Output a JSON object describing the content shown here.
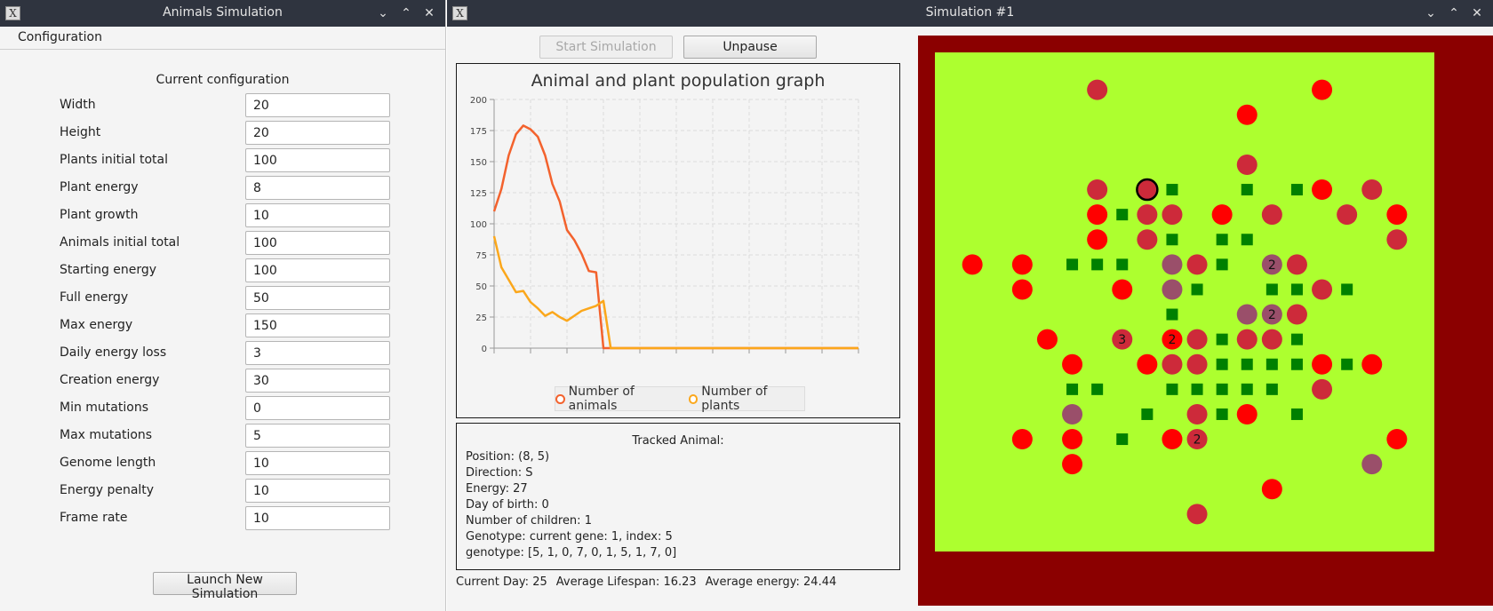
{
  "left_window": {
    "title": "Animals Simulation",
    "menu": [
      "Configuration"
    ],
    "config_title": "Current configuration",
    "fields": [
      {
        "label": "Width",
        "value": "20"
      },
      {
        "label": "Height",
        "value": "20"
      },
      {
        "label": "Plants initial total",
        "value": "100"
      },
      {
        "label": "Plant energy",
        "value": "8"
      },
      {
        "label": "Plant growth",
        "value": "10"
      },
      {
        "label": "Animals initial total",
        "value": "100"
      },
      {
        "label": "Starting energy",
        "value": "100"
      },
      {
        "label": "Full energy",
        "value": "50"
      },
      {
        "label": "Max energy",
        "value": "150"
      },
      {
        "label": "Daily energy loss",
        "value": "3"
      },
      {
        "label": "Creation energy",
        "value": "30"
      },
      {
        "label": "Min mutations",
        "value": "0"
      },
      {
        "label": "Max mutations",
        "value": "5"
      },
      {
        "label": "Genome length",
        "value": "10"
      },
      {
        "label": "Energy penalty",
        "value": "10"
      },
      {
        "label": "Frame rate",
        "value": "10"
      }
    ],
    "launch_label": "Launch New Simulation"
  },
  "right_window": {
    "title": "Simulation #1",
    "start_label": "Start Simulation",
    "unpause_label": "Unpause",
    "tracked": {
      "title": "Tracked Animal:",
      "lines": [
        "Position: (8, 5)",
        "Direction: S",
        "Energy: 27",
        "Day of birth: 0",
        "Number of children: 1",
        "Genotype: current gene: 1, index: 5",
        "genotype: [5, 1, 0, 7, 0, 1, 5, 1, 7, 0]"
      ]
    },
    "status": {
      "day": "Current Day: 25",
      "lifespan": "Average Lifespan: 16.23",
      "energy": "Average energy: 24.44"
    }
  },
  "chart_data": {
    "type": "line",
    "title": "Animal and plant population graph",
    "ylim": [
      0,
      200
    ],
    "y_ticks": [
      "0",
      "25",
      "50",
      "75",
      "100",
      "125",
      "150",
      "175",
      "200"
    ],
    "xlim": [
      0,
      25
    ],
    "series": [
      {
        "name": "Number of animals",
        "color": "#f3622d",
        "x": [
          0,
          0.5,
          1,
          1.5,
          2,
          2.5,
          3,
          3.5,
          4,
          4.5,
          5,
          5.5,
          6,
          6.5,
          7,
          7.5,
          8,
          8.5,
          9,
          9.5,
          10,
          25
        ],
        "y": [
          110,
          128,
          155,
          172,
          179,
          176,
          170,
          155,
          132,
          118,
          95,
          87,
          76,
          62,
          61,
          0,
          0,
          0,
          0,
          0,
          0,
          0
        ]
      },
      {
        "name": "Number of plants",
        "color": "#fba71b",
        "x": [
          0,
          0.5,
          1,
          1.5,
          2,
          2.5,
          3,
          3.5,
          4,
          4.5,
          5,
          5.5,
          6,
          6.5,
          7,
          7.5,
          8,
          25
        ],
        "y": [
          90,
          65,
          55,
          45,
          46,
          37,
          32,
          26,
          29,
          25,
          22,
          26,
          30,
          32,
          34,
          38,
          0,
          0
        ]
      }
    ]
  },
  "map": {
    "grid_width": 20,
    "grid_height": 20,
    "colors": {
      "border": "#8b0000",
      "steppe": "#adff2f",
      "plant": "#008000",
      "animal_full": "#ff0000",
      "animal_mid": "#cd2a3a",
      "animal_low": "#9a4f6a",
      "tracked_outline": "#000000"
    },
    "plants": [
      [
        9,
        5
      ],
      [
        12,
        5
      ],
      [
        14,
        5
      ],
      [
        7,
        6
      ],
      [
        9,
        7
      ],
      [
        11,
        7
      ],
      [
        12,
        7
      ],
      [
        5,
        8
      ],
      [
        6,
        8
      ],
      [
        7,
        8
      ],
      [
        11,
        8
      ],
      [
        10,
        9
      ],
      [
        13,
        9
      ],
      [
        14,
        9
      ],
      [
        16,
        9
      ],
      [
        9,
        10
      ],
      [
        11,
        11
      ],
      [
        14,
        11
      ],
      [
        11,
        12
      ],
      [
        12,
        12
      ],
      [
        13,
        12
      ],
      [
        14,
        12
      ],
      [
        15,
        12
      ],
      [
        16,
        12
      ],
      [
        5,
        13
      ],
      [
        6,
        13
      ],
      [
        9,
        13
      ],
      [
        10,
        13
      ],
      [
        11,
        13
      ],
      [
        12,
        13
      ],
      [
        13,
        13
      ],
      [
        8,
        14
      ],
      [
        11,
        14
      ],
      [
        14,
        14
      ],
      [
        7,
        15
      ]
    ],
    "animals": [
      {
        "x": 6,
        "y": 1,
        "level": "mid"
      },
      {
        "x": 15,
        "y": 1,
        "level": "full"
      },
      {
        "x": 12,
        "y": 2,
        "level": "full"
      },
      {
        "x": 12,
        "y": 4,
        "level": "mid"
      },
      {
        "x": 6,
        "y": 5,
        "level": "mid"
      },
      {
        "x": 8,
        "y": 5,
        "level": "mid",
        "tracked": true
      },
      {
        "x": 15,
        "y": 5,
        "level": "full"
      },
      {
        "x": 17,
        "y": 5,
        "level": "mid"
      },
      {
        "x": 6,
        "y": 6,
        "level": "full"
      },
      {
        "x": 8,
        "y": 6,
        "level": "mid"
      },
      {
        "x": 9,
        "y": 6,
        "level": "mid"
      },
      {
        "x": 11,
        "y": 6,
        "level": "full"
      },
      {
        "x": 13,
        "y": 6,
        "level": "mid"
      },
      {
        "x": 16,
        "y": 6,
        "level": "mid"
      },
      {
        "x": 18,
        "y": 6,
        "level": "full"
      },
      {
        "x": 6,
        "y": 7,
        "level": "full"
      },
      {
        "x": 8,
        "y": 7,
        "level": "mid"
      },
      {
        "x": 18,
        "y": 7,
        "level": "mid"
      },
      {
        "x": 1,
        "y": 8,
        "level": "full"
      },
      {
        "x": 3,
        "y": 8,
        "level": "full"
      },
      {
        "x": 9,
        "y": 8,
        "level": "low"
      },
      {
        "x": 10,
        "y": 8,
        "level": "mid"
      },
      {
        "x": 13,
        "y": 8,
        "level": "low",
        "count": "2"
      },
      {
        "x": 14,
        "y": 8,
        "level": "mid"
      },
      {
        "x": 3,
        "y": 9,
        "level": "full"
      },
      {
        "x": 7,
        "y": 9,
        "level": "full"
      },
      {
        "x": 9,
        "y": 9,
        "level": "low"
      },
      {
        "x": 15,
        "y": 9,
        "level": "mid"
      },
      {
        "x": 12,
        "y": 10,
        "level": "low"
      },
      {
        "x": 13,
        "y": 10,
        "level": "low",
        "count": "2"
      },
      {
        "x": 14,
        "y": 10,
        "level": "mid"
      },
      {
        "x": 4,
        "y": 11,
        "level": "full"
      },
      {
        "x": 7,
        "y": 11,
        "level": "mid",
        "count": "3"
      },
      {
        "x": 9,
        "y": 11,
        "level": "full",
        "count": "2"
      },
      {
        "x": 10,
        "y": 11,
        "level": "mid"
      },
      {
        "x": 12,
        "y": 11,
        "level": "mid"
      },
      {
        "x": 13,
        "y": 11,
        "level": "mid"
      },
      {
        "x": 5,
        "y": 12,
        "level": "full"
      },
      {
        "x": 8,
        "y": 12,
        "level": "full"
      },
      {
        "x": 9,
        "y": 12,
        "level": "mid"
      },
      {
        "x": 10,
        "y": 12,
        "level": "mid"
      },
      {
        "x": 15,
        "y": 12,
        "level": "full"
      },
      {
        "x": 17,
        "y": 12,
        "level": "full"
      },
      {
        "x": 15,
        "y": 13,
        "level": "mid"
      },
      {
        "x": 5,
        "y": 14,
        "level": "low"
      },
      {
        "x": 10,
        "y": 14,
        "level": "mid"
      },
      {
        "x": 12,
        "y": 14,
        "level": "full"
      },
      {
        "x": 3,
        "y": 15,
        "level": "full"
      },
      {
        "x": 5,
        "y": 15,
        "level": "full"
      },
      {
        "x": 9,
        "y": 15,
        "level": "full"
      },
      {
        "x": 10,
        "y": 15,
        "level": "mid",
        "count": "2"
      },
      {
        "x": 18,
        "y": 15,
        "level": "full"
      },
      {
        "x": 5,
        "y": 16,
        "level": "full"
      },
      {
        "x": 17,
        "y": 16,
        "level": "low"
      },
      {
        "x": 13,
        "y": 17,
        "level": "full"
      },
      {
        "x": 10,
        "y": 18,
        "level": "mid"
      }
    ]
  }
}
